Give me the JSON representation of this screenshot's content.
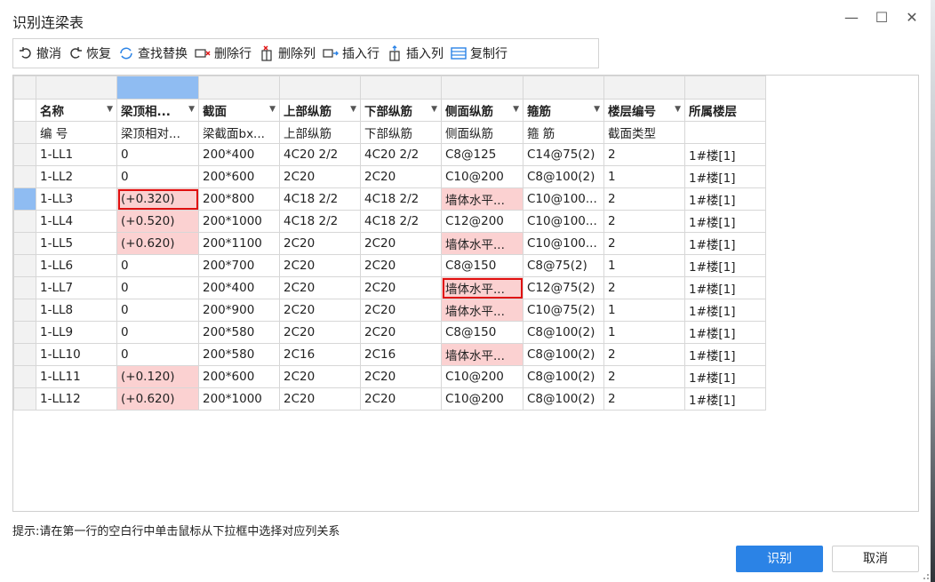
{
  "window": {
    "title": "识别连梁表",
    "minimize": "—",
    "maximize": "☐",
    "close": "✕"
  },
  "toolbar": {
    "undo": "撤消",
    "redo": "恢复",
    "find_replace": "查找替换",
    "delete_row": "删除行",
    "delete_col": "删除列",
    "insert_row": "插入行",
    "insert_col": "插入列",
    "copy_row": "复制行"
  },
  "columns": [
    "名称",
    "梁顶相...",
    "截面",
    "上部纵筋",
    "下部纵筋",
    "侧面纵筋",
    "箍筋",
    "楼层编号",
    "所属楼层"
  ],
  "subheader": [
    "编 号",
    "梁顶相对...",
    "梁截面bx...",
    "上部纵筋",
    "下部纵筋",
    "侧面纵筋",
    "箍 筋",
    "截面类型",
    ""
  ],
  "rows": [
    [
      "1-LL1",
      "0",
      "200*400",
      "4C20 2/2",
      "4C20 2/2",
      "C8@125",
      "C14@75(2)",
      "2",
      "1#楼[1]"
    ],
    [
      "1-LL2",
      "0",
      "200*600",
      "2C20",
      "2C20",
      "C10@200",
      "C8@100(2)",
      "1",
      "1#楼[1]"
    ],
    [
      "1-LL3",
      "(+0.320)",
      "200*800",
      "4C18 2/2",
      "4C18 2/2",
      "墙体水平...",
      "C10@100...",
      "2",
      "1#楼[1]"
    ],
    [
      "1-LL4",
      "(+0.520)",
      "200*1000",
      "4C18 2/2",
      "4C18 2/2",
      "C12@200",
      "C10@100...",
      "2",
      "1#楼[1]"
    ],
    [
      "1-LL5",
      "(+0.620)",
      "200*1100",
      "2C20",
      "2C20",
      "墙体水平...",
      "C10@100...",
      "2",
      "1#楼[1]"
    ],
    [
      "1-LL6",
      "0",
      "200*700",
      "2C20",
      "2C20",
      "C8@150",
      "C8@75(2)",
      "1",
      "1#楼[1]"
    ],
    [
      "1-LL7",
      "0",
      "200*400",
      "2C20",
      "2C20",
      "墙体水平...",
      "C12@75(2)",
      "2",
      "1#楼[1]"
    ],
    [
      "1-LL8",
      "0",
      "200*900",
      "2C20",
      "2C20",
      "墙体水平...",
      "C10@75(2)",
      "1",
      "1#楼[1]"
    ],
    [
      "1-LL9",
      "0",
      "200*580",
      "2C20",
      "2C20",
      "C8@150",
      "C8@100(2)",
      "1",
      "1#楼[1]"
    ],
    [
      "1-LL10",
      "0",
      "200*580",
      "2C16",
      "2C16",
      "墙体水平...",
      "C8@100(2)",
      "2",
      "1#楼[1]"
    ],
    [
      "1-LL11",
      "(+0.120)",
      "200*600",
      "2C20",
      "2C20",
      "C10@200",
      "C8@100(2)",
      "2",
      "1#楼[1]"
    ],
    [
      "1-LL12",
      "(+0.620)",
      "200*1000",
      "2C20",
      "2C20",
      "C10@200",
      "C8@100(2)",
      "2",
      "1#楼[1]"
    ]
  ],
  "hint": "提示:请在第一行的空白行中单击鼠标从下拉框中选择对应列关系",
  "buttons": {
    "ok": "识别",
    "cancel": "取消"
  },
  "colors": {
    "accent": "#2b83e6",
    "highlight": "#fbd1d1",
    "selection": "#8fbcf2",
    "error_box": "#e01010"
  }
}
